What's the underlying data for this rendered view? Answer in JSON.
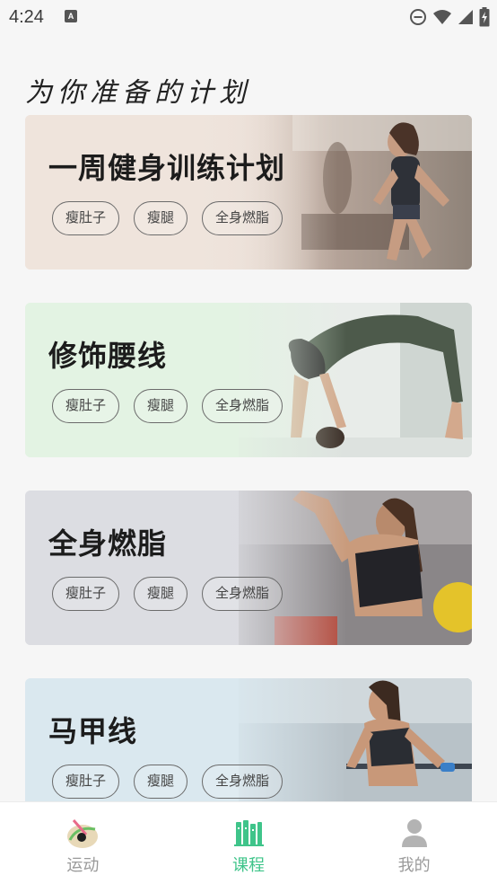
{
  "status_bar": {
    "time": "4:24",
    "icons": [
      "notification-a-icon",
      "do-not-disturb-icon",
      "wifi-icon",
      "cell-signal-icon",
      "battery-charging-icon"
    ]
  },
  "page": {
    "title": "为你准备的计划"
  },
  "plans": [
    {
      "title": "一周健身训练计划",
      "tags": [
        "瘦肚子",
        "瘦腿",
        "全身燃脂"
      ],
      "bg_color": "#efe4dc",
      "photo_desc": "treadmill-runner-photo"
    },
    {
      "title": "修饰腰线",
      "tags": [
        "瘦肚子",
        "瘦腿",
        "全身燃脂"
      ],
      "bg_color": "#e3f3e3",
      "photo_desc": "yoga-backbend-photo"
    },
    {
      "title": "全身燃脂",
      "tags": [
        "瘦肚子",
        "瘦腿",
        "全身燃脂"
      ],
      "bg_color": "#dcdde2",
      "photo_desc": "gym-flex-photo"
    },
    {
      "title": "马甲线",
      "tags": [
        "瘦肚子",
        "瘦腿",
        "全身燃脂"
      ],
      "bg_color": "#dbe9f0",
      "photo_desc": "parallel-bars-photo"
    }
  ],
  "bottom_nav": {
    "items": [
      {
        "label": "运动",
        "icon": "workout-icon",
        "active": false
      },
      {
        "label": "课程",
        "icon": "courses-icon",
        "active": true
      },
      {
        "label": "我的",
        "icon": "profile-icon",
        "active": false
      }
    ],
    "active_color": "#3fc48a",
    "inactive_color": "#9a9a9a"
  }
}
